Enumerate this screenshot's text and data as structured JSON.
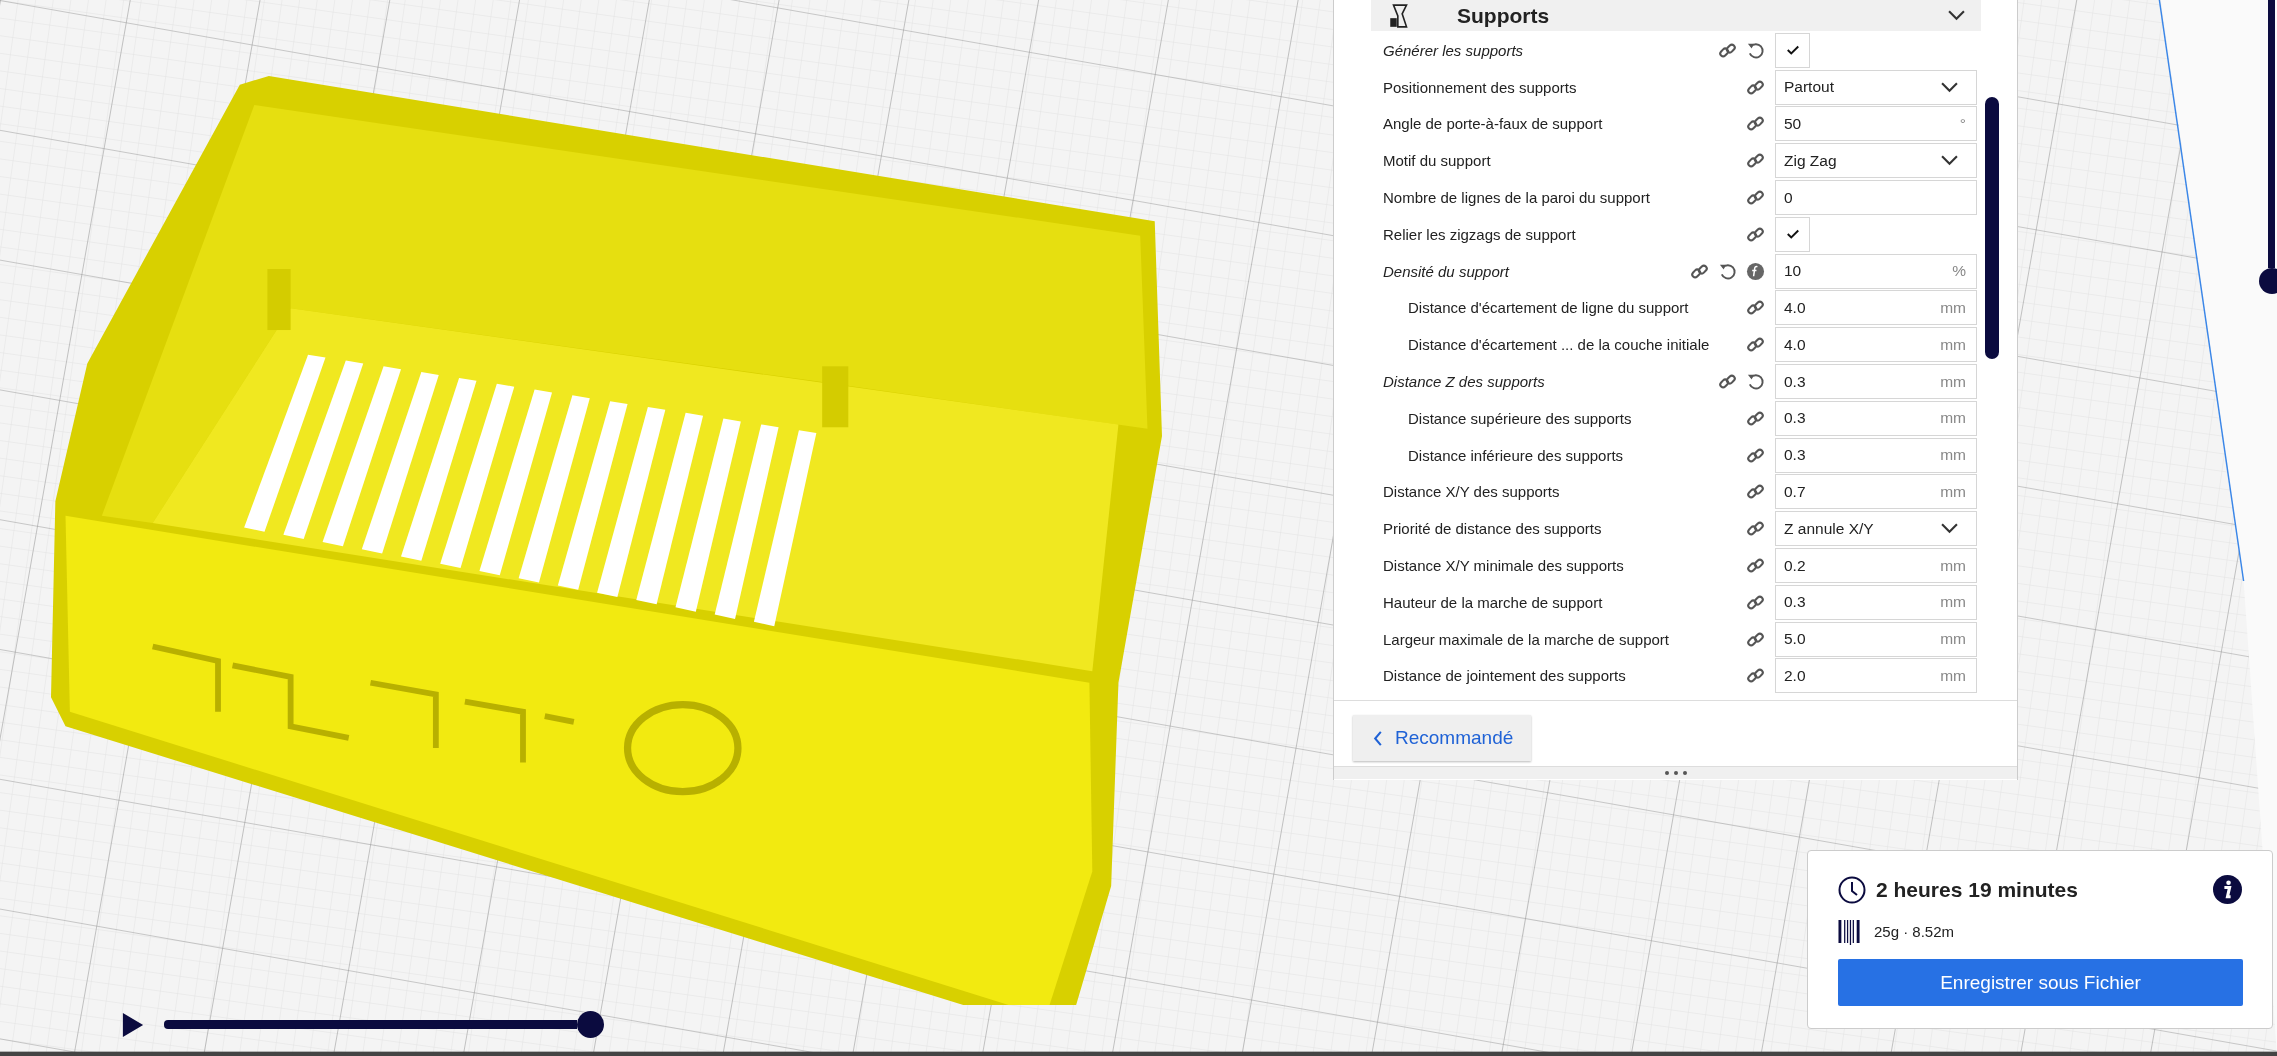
{
  "settings_panel": {
    "section": {
      "title": "Supports",
      "expanded": true
    },
    "settings": [
      {
        "label": "Générer les supports",
        "modified": true,
        "formula": false,
        "kind": "checkbox",
        "checked": true
      },
      {
        "label": "Positionnement des supports",
        "modified": false,
        "formula": false,
        "kind": "dropdown",
        "value": "Partout"
      },
      {
        "label": "Angle de porte-à-faux de support",
        "modified": false,
        "formula": false,
        "kind": "number",
        "value": "50",
        "unit": "°"
      },
      {
        "label": "Motif du support",
        "modified": false,
        "formula": false,
        "kind": "dropdown",
        "value": "Zig Zag"
      },
      {
        "label": "Nombre de lignes de la paroi du support",
        "modified": false,
        "formula": false,
        "kind": "number",
        "value": "0"
      },
      {
        "label": "Relier les zigzags de support",
        "modified": false,
        "formula": false,
        "kind": "checkbox",
        "checked": true
      },
      {
        "label": "Densité du support",
        "modified": true,
        "formula": true,
        "kind": "number",
        "value": "10",
        "unit": "%",
        "children": [
          {
            "label": "Distance d'écartement de ligne du support",
            "modified": false,
            "formula": false,
            "kind": "number",
            "value": "4.0",
            "unit": "mm"
          },
          {
            "label": "Distance d'écartement ... de la couche initiale",
            "modified": false,
            "formula": false,
            "kind": "number",
            "value": "4.0",
            "unit": "mm"
          }
        ]
      },
      {
        "label": "Distance Z des supports",
        "modified": true,
        "formula": false,
        "kind": "number",
        "value": "0.3",
        "unit": "mm",
        "children": [
          {
            "label": "Distance supérieure des supports",
            "modified": false,
            "formula": false,
            "kind": "number",
            "value": "0.3",
            "unit": "mm"
          },
          {
            "label": "Distance inférieure des supports",
            "modified": false,
            "formula": false,
            "kind": "number",
            "value": "0.3",
            "unit": "mm"
          }
        ]
      },
      {
        "label": "Distance X/Y des supports",
        "modified": false,
        "formula": false,
        "kind": "number",
        "value": "0.7",
        "unit": "mm"
      },
      {
        "label": "Priorité de distance des supports",
        "modified": false,
        "formula": false,
        "kind": "dropdown",
        "value": "Z annule X/Y"
      },
      {
        "label": "Distance X/Y minimale des supports",
        "modified": false,
        "formula": false,
        "kind": "number",
        "value": "0.2",
        "unit": "mm"
      },
      {
        "label": "Hauteur de la marche de support",
        "modified": false,
        "formula": false,
        "kind": "number",
        "value": "0.3",
        "unit": "mm"
      },
      {
        "label": "Largeur maximale de la marche de support",
        "modified": false,
        "formula": false,
        "kind": "number",
        "value": "5.0",
        "unit": "mm"
      },
      {
        "label": "Distance de jointement des supports",
        "modified": false,
        "formula": false,
        "kind": "number",
        "value": "2.0",
        "unit": "mm"
      }
    ],
    "back_button": "Recommandé"
  },
  "print_summary": {
    "time": "2 heures 19 minutes",
    "material": "25g · 8.52m",
    "save_button": "Enregistrer sous Fichier"
  },
  "layer_preview": {
    "level": 1
  }
}
